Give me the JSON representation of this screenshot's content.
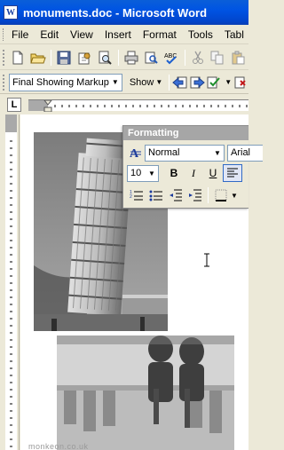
{
  "window": {
    "title": "monuments.doc - Microsoft Word",
    "icon": "word-doc-icon",
    "icon_glyph": "W"
  },
  "menu": {
    "items": [
      {
        "label": "File"
      },
      {
        "label": "Edit"
      },
      {
        "label": "View"
      },
      {
        "label": "Insert"
      },
      {
        "label": "Format"
      },
      {
        "label": "Tools"
      },
      {
        "label": "Tabl"
      }
    ]
  },
  "standard_toolbar": {
    "buttons": [
      "new-document-icon",
      "open-folder-icon",
      "save-icon",
      "permission-icon",
      "print-preview-icon",
      "print-icon",
      "research-icon",
      "spelling-icon",
      "cut-icon",
      "copy-icon",
      "paste-icon"
    ]
  },
  "reviewing_toolbar": {
    "display_mode": "Final Showing Markup",
    "show_label": "Show",
    "buttons": [
      "previous-change-icon",
      "next-change-icon",
      "accept-change-icon"
    ]
  },
  "ruler": {
    "tab_selector": "L"
  },
  "formatting_toolbar": {
    "title": "Formatting",
    "style_value": "Normal",
    "font_value": "Arial",
    "size_value": "10",
    "bold_label": "B",
    "italic_label": "I",
    "underline_label": "U"
  },
  "watermark": "monkeon.co.uk",
  "colors": {
    "titlebar": "#0054e3",
    "chrome": "#ece9d8",
    "page": "#ffffff",
    "floating_title": "#a6a6a6"
  }
}
